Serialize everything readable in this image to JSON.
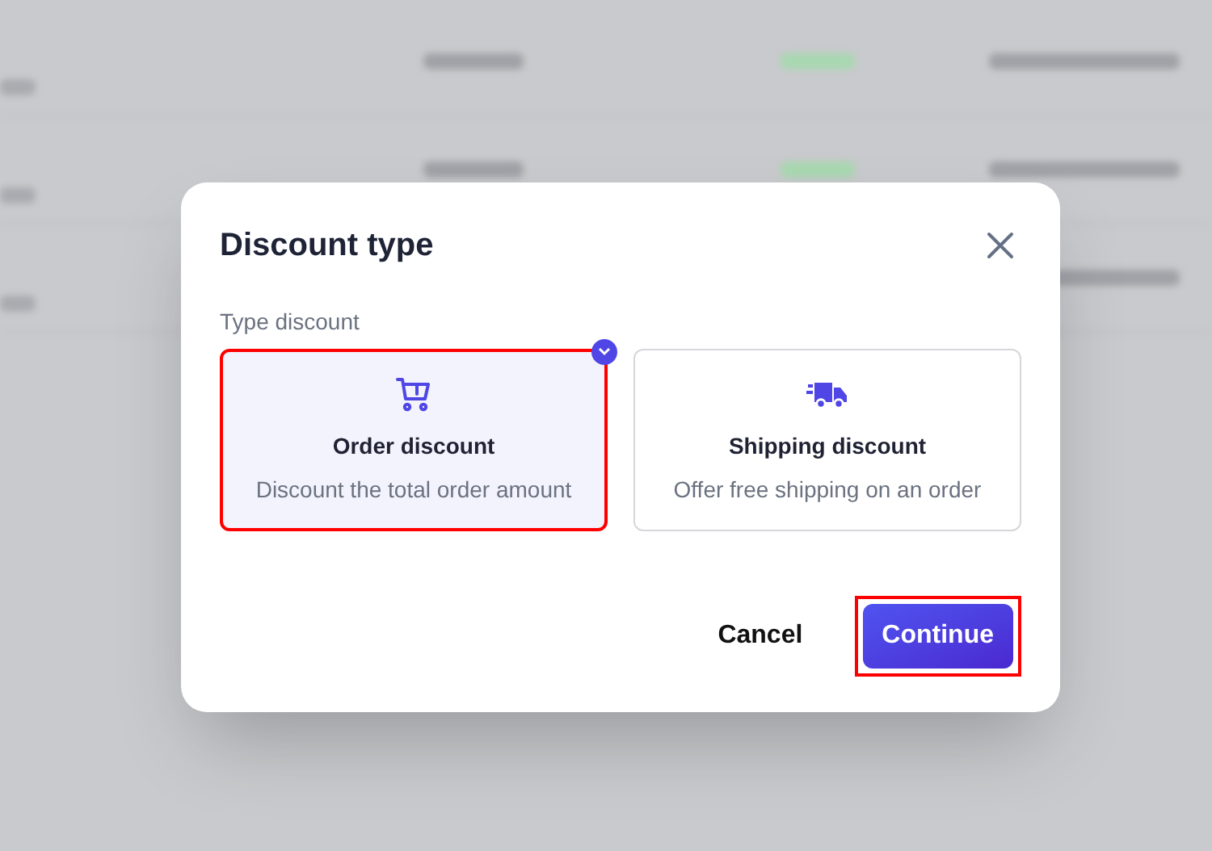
{
  "dialog": {
    "title": "Discount type",
    "label": "Type discount",
    "options": [
      {
        "kind": "cart",
        "title": "Order discount",
        "description": "Discount the total order amount",
        "selected": true
      },
      {
        "kind": "truck",
        "title": "Shipping discount",
        "description": "Offer free shipping on an order",
        "selected": false
      }
    ],
    "buttons": [
      {
        "kind": "secondary",
        "label": "Cancel",
        "highlighted": false
      },
      {
        "kind": "primary",
        "label": "Continue",
        "highlighted": true
      }
    ]
  }
}
